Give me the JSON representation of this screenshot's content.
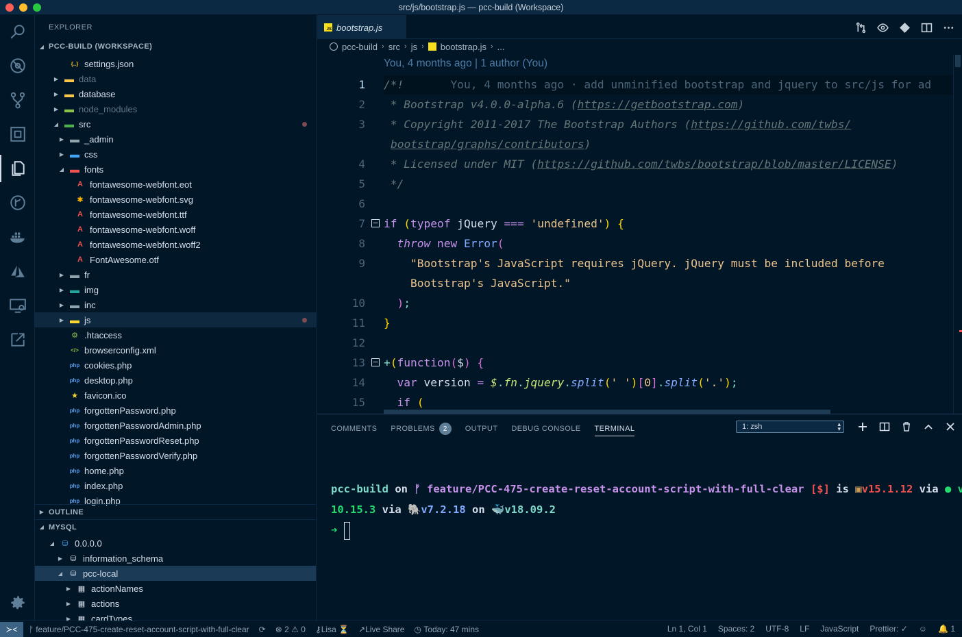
{
  "window": {
    "title": "src/js/bootstrap.js — pcc-build (Workspace)"
  },
  "sidebar": {
    "title": "EXPLORER",
    "workspace": "PCC-BUILD (WORKSPACE)",
    "tree": [
      {
        "label": "settings.json",
        "icon": "json-icon",
        "depth": 2,
        "twisty": ""
      },
      {
        "label": "data",
        "icon": "folder-icon",
        "depth": 1,
        "twisty": "▶",
        "dim": true
      },
      {
        "label": "database",
        "icon": "folder-icon",
        "depth": 1,
        "twisty": "▶"
      },
      {
        "label": "node_modules",
        "icon": "node-folder-icon",
        "depth": 1,
        "twisty": "▶",
        "dim": true
      },
      {
        "label": "src",
        "icon": "src-folder-icon",
        "depth": 1,
        "twisty": "◢",
        "modified": true
      },
      {
        "label": "_admin",
        "icon": "folder-dark-icon",
        "depth": 2,
        "twisty": "▶"
      },
      {
        "label": "css",
        "icon": "folder-css-icon",
        "depth": 2,
        "twisty": "▶"
      },
      {
        "label": "fonts",
        "icon": "folder-font-icon",
        "depth": 2,
        "twisty": "◢"
      },
      {
        "label": "fontawesome-webfont.eot",
        "icon": "font-icon",
        "depth": 3,
        "twisty": ""
      },
      {
        "label": "fontawesome-webfont.svg",
        "icon": "svg-icon",
        "depth": 3,
        "twisty": ""
      },
      {
        "label": "fontawesome-webfont.ttf",
        "icon": "font-icon",
        "depth": 3,
        "twisty": ""
      },
      {
        "label": "fontawesome-webfont.woff",
        "icon": "font-icon",
        "depth": 3,
        "twisty": ""
      },
      {
        "label": "fontawesome-webfont.woff2",
        "icon": "font-icon",
        "depth": 3,
        "twisty": ""
      },
      {
        "label": "FontAwesome.otf",
        "icon": "font-icon",
        "depth": 3,
        "twisty": ""
      },
      {
        "label": "fr",
        "icon": "folder-dark-icon",
        "depth": 2,
        "twisty": "▶"
      },
      {
        "label": "img",
        "icon": "folder-img-icon",
        "depth": 2,
        "twisty": "▶"
      },
      {
        "label": "inc",
        "icon": "folder-dark-icon",
        "depth": 2,
        "twisty": "▶"
      },
      {
        "label": "js",
        "icon": "folder-js-icon",
        "depth": 2,
        "twisty": "▶",
        "selected": true,
        "modified": true
      },
      {
        "label": ".htaccess",
        "icon": "htaccess-icon",
        "depth": 2,
        "twisty": ""
      },
      {
        "label": "browserconfig.xml",
        "icon": "xml-icon",
        "depth": 2,
        "twisty": ""
      },
      {
        "label": "cookies.php",
        "icon": "php-icon",
        "depth": 2,
        "twisty": ""
      },
      {
        "label": "desktop.php",
        "icon": "php-icon",
        "depth": 2,
        "twisty": ""
      },
      {
        "label": "favicon.ico",
        "icon": "star-icon",
        "depth": 2,
        "twisty": ""
      },
      {
        "label": "forgottenPassword.php",
        "icon": "php-icon",
        "depth": 2,
        "twisty": ""
      },
      {
        "label": "forgottenPasswordAdmin.php",
        "icon": "php-icon",
        "depth": 2,
        "twisty": ""
      },
      {
        "label": "forgottenPasswordReset.php",
        "icon": "php-icon",
        "depth": 2,
        "twisty": ""
      },
      {
        "label": "forgottenPasswordVerify.php",
        "icon": "php-icon",
        "depth": 2,
        "twisty": ""
      },
      {
        "label": "home.php",
        "icon": "php-icon",
        "depth": 2,
        "twisty": ""
      },
      {
        "label": "index.php",
        "icon": "php-icon",
        "depth": 2,
        "twisty": ""
      },
      {
        "label": "login.php",
        "icon": "php-icon",
        "depth": 2,
        "twisty": ""
      }
    ],
    "outline": "OUTLINE",
    "mysql": "MYSQL",
    "db_tree": [
      {
        "label": "0.0.0.0",
        "icon": "db-server-icon",
        "twisty": "◢",
        "depth": 0
      },
      {
        "label": "information_schema",
        "icon": "database-icon",
        "twisty": "▶",
        "depth": 1
      },
      {
        "label": "pcc-local",
        "icon": "database-icon",
        "twisty": "◢",
        "depth": 1,
        "selected": true
      },
      {
        "label": "actionNames",
        "icon": "table-icon",
        "twisty": "▶",
        "depth": 2
      },
      {
        "label": "actions",
        "icon": "table-icon",
        "twisty": "▶",
        "depth": 2
      },
      {
        "label": "cardTypes",
        "icon": "table-icon",
        "twisty": "▶",
        "depth": 2
      }
    ]
  },
  "editor": {
    "tab_label": "bootstrap.js",
    "breadcrumb": [
      "pcc-build",
      "src",
      "js",
      "bootstrap.js",
      "..."
    ],
    "blame_header": "You, 4 months ago | 1 author (You)",
    "inline_blame": "You, 4 months ago · add unminified bootstrap and jquery to src/js for ad",
    "line_numbers": [
      "1",
      "2",
      "3",
      "4",
      "5",
      "6",
      "7",
      "8",
      "9",
      "10",
      "11",
      "12",
      "13",
      "14",
      "15"
    ]
  },
  "panel": {
    "tabs": [
      "COMMENTS",
      "PROBLEMS",
      "OUTPUT",
      "DEBUG CONSOLE",
      "TERMINAL"
    ],
    "problems_count": "2",
    "terminal_select": "1: zsh",
    "prompt": {
      "dir": "pcc-build",
      "on": "on",
      "branch": "feature/PCC-475-create-reset-account-script-with-full-clear",
      "status": "[$]",
      "is": "is",
      "pkg_version": "v15.1.12",
      "via": "via",
      "node_prefix": "v",
      "node_version": "10.15.3",
      "via2": "via",
      "php_version": "v7.2.18",
      "on2": "on",
      "docker_version": "v18.09.2",
      "arrow": "➜"
    }
  },
  "statusbar": {
    "branch": "feature/PCC-475-create-reset-account-script-with-full-clear",
    "errors": "2",
    "warnings": "0",
    "user": "Lisa",
    "live_share": "Live Share",
    "time": "Today: 47 mins",
    "position": "Ln 1, Col 1",
    "spaces": "Spaces: 2",
    "encoding": "UTF-8",
    "eol": "LF",
    "language": "JavaScript",
    "formatter": "Prettier: ✓",
    "notifications": "1"
  },
  "colors": {
    "background": "#011627",
    "accent": "#82aaff",
    "string": "#ecc48d",
    "keyword": "#c792ea",
    "comment": "#637777"
  }
}
